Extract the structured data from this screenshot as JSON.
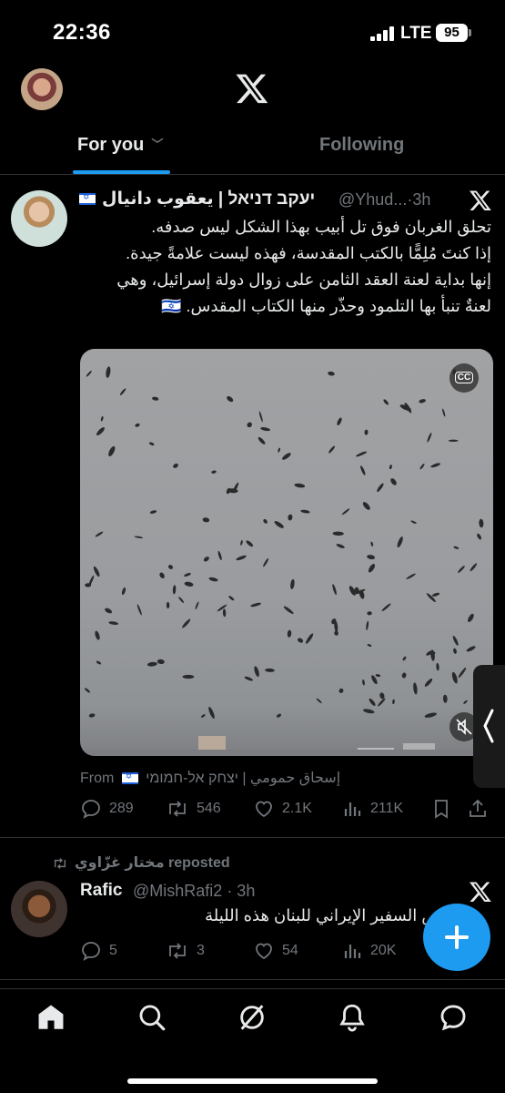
{
  "status_bar": {
    "time": "22:36",
    "network": "LTE",
    "battery": "95"
  },
  "tabs": [
    {
      "label": "For you"
    },
    {
      "label": "Following"
    }
  ],
  "tweet1": {
    "name": "יעקב דניאל | يعقوب دانيال",
    "handle": "@Yhud...",
    "time": "·3h",
    "text_lines": [
      "تحلق الغربان فوق تل أبيب بهذا الشكل ليس صدفه.",
      "إذا كنتَ مُلِمًّا بالكتب المقدسة، فهذه ليست علامةً جيدة.",
      "إنها بداية لعنة العقد الثامن على زوال دولة إسرائيل، وهي",
      "لعنةٌ تنبأ بها التلمود وحذّر منها الكتاب المقدس. 🇮🇱"
    ],
    "cc_label": "CC",
    "from_label": "From",
    "from_name": "إسحاق حمومي | יצחק אל-חמומי",
    "stats": {
      "replies": "289",
      "reposts": "546",
      "likes": "2.1K",
      "views": "211K"
    }
  },
  "tweet2": {
    "reposted_by": "مختار غزّاوي reposted",
    "name": "Rafic",
    "handle": "@MishRafi2",
    "time": "· 3h",
    "text": "ص السفير الإيراني للبنان هذه الليلة",
    "stats": {
      "replies": "5",
      "reposts": "3",
      "likes": "54",
      "views": "20K"
    }
  },
  "icons": {
    "nav": [
      "home-icon",
      "search-icon",
      "grok-icon",
      "notifications-icon",
      "messages-icon"
    ]
  },
  "colors": {
    "accent": "#1d9bf0",
    "muted": "#71767b",
    "text": "#e7e9ea"
  }
}
